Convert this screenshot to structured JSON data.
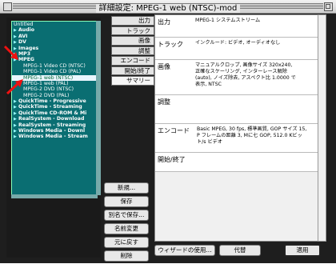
{
  "window": {
    "title": "詳細設定: MPEG-1 web (NTSC)-mod"
  },
  "tree": {
    "items": [
      {
        "label": "Untitled",
        "level": 0,
        "bold": false,
        "tri": false
      },
      {
        "label": "Audio",
        "level": 0,
        "bold": true,
        "tri": true
      },
      {
        "label": "AVI",
        "level": 0,
        "bold": true,
        "tri": true
      },
      {
        "label": "DV",
        "level": 0,
        "bold": true,
        "tri": true
      },
      {
        "label": "Images",
        "level": 0,
        "bold": true,
        "tri": true
      },
      {
        "label": "MP3",
        "level": 0,
        "bold": true,
        "tri": true
      },
      {
        "label": "MPEG",
        "level": 0,
        "bold": true,
        "tri": true
      },
      {
        "label": "MPEG-1 Video CD (NTSC)",
        "level": 2,
        "bold": false,
        "tri": false
      },
      {
        "label": "MPEG-1 Video CD (PAL)",
        "level": 2,
        "bold": false,
        "tri": false
      },
      {
        "label": "MPEG-1 web (NTSC)",
        "level": 2,
        "bold": false,
        "tri": false,
        "selected": true
      },
      {
        "label": "MPEG-1 web (PAL)",
        "level": 2,
        "bold": false,
        "tri": false
      },
      {
        "label": "MPEG-2 DVD (NTSC)",
        "level": 2,
        "bold": false,
        "tri": false
      },
      {
        "label": "MPEG-2 DVD (PAL)",
        "level": 2,
        "bold": false,
        "tri": false
      },
      {
        "label": "QuickTime - Progressive",
        "level": 0,
        "bold": true,
        "tri": true
      },
      {
        "label": "QuickTime - Streaming",
        "level": 0,
        "bold": true,
        "tri": true
      },
      {
        "label": "QuickTime CD-ROM & Mi",
        "level": 0,
        "bold": true,
        "tri": true
      },
      {
        "label": "RealSystem - Download",
        "level": 0,
        "bold": true,
        "tri": true
      },
      {
        "label": "RealSystem - Streaming",
        "level": 0,
        "bold": true,
        "tri": true
      },
      {
        "label": "Windows Media - Downl",
        "level": 0,
        "bold": true,
        "tri": true
      },
      {
        "label": "Windows Media - Stream",
        "level": 0,
        "bold": true,
        "tri": true
      }
    ]
  },
  "side_buttons": [
    "新規...",
    "保存",
    "別名で保存...",
    "名前変更",
    "元に戻す",
    "削除"
  ],
  "tabs": [
    "出力",
    "トラック",
    "画像",
    "調整",
    "エンコード",
    "開始/終了",
    "サマリー"
  ],
  "active_tab": "サマリー",
  "summary": [
    {
      "label": "出力",
      "value": "MPEG-1 システムストリーム"
    },
    {
      "label": "トラック",
      "value": "インクルード: ビデオ, オーディオなし"
    },
    {
      "label": "画像",
      "value": "マニュアルクロップ, 画像サイズ 320x240, 正確なスケーリング, インターレース解除 (auto), ノイズ除去, アスペクト比 1.0000 で表示, NTSC"
    },
    {
      "label": "調整",
      "value": ""
    },
    {
      "label": "エンコード",
      "value": "Basic MPEG, 30 fps, 標準画質, GOP サイズ 15, P フレームの距離 3, Mに七 GOP, 512.0 Kビット/s ビデオ"
    },
    {
      "label": "開始/終了",
      "value": ""
    }
  ],
  "bottom": {
    "wizard": "ウィザードの使用...",
    "cancel": "代替",
    "apply": "適用"
  }
}
